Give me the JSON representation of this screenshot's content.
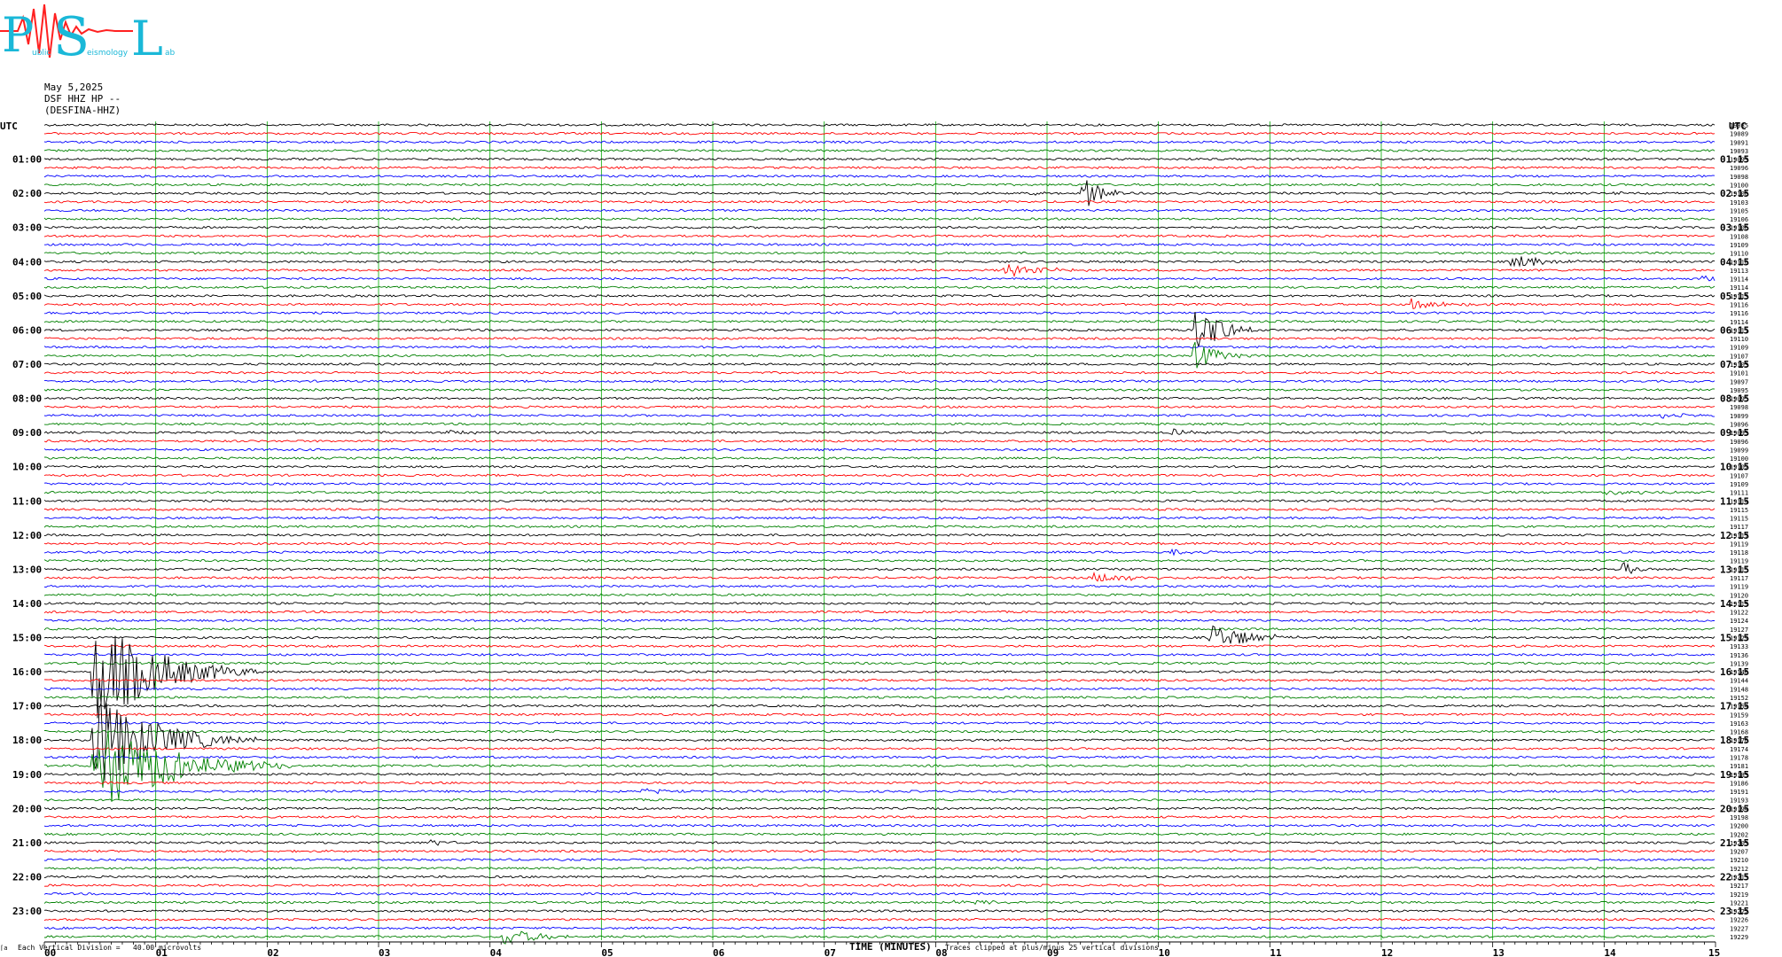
{
  "logo": {
    "letters": [
      "P",
      "S",
      "L"
    ],
    "subtitle_fragments": [
      "ublic",
      "eismology",
      "ab"
    ],
    "color": "#1ab8d8"
  },
  "header": {
    "date": "May 5,2025",
    "channel": "DSF HHZ HP --",
    "station": "(DESFINA-HHZ)"
  },
  "labels": {
    "utc_left": "UTC",
    "utc_right": "UTC",
    "xlabel": "TIME (MINUTES)",
    "scale_note": "Each Vertical Division =   40.00 microvolts",
    "clip_note": "Traces clipped at plus/minus 25 vertical divisions",
    "corner_mark": "⌈a"
  },
  "colors": {
    "trace_cycle": [
      "#000000",
      "#ff0000",
      "#0000ff",
      "#008000"
    ],
    "grid": "#00aa00"
  },
  "chart_data": {
    "type": "line",
    "title": "",
    "xlabel": "TIME (MINUTES)",
    "xlim": [
      0,
      15
    ],
    "x_ticks": [
      "00",
      "01",
      "02",
      "03",
      "04",
      "05",
      "06",
      "07",
      "08",
      "09",
      "10",
      "11",
      "12",
      "13",
      "14",
      "15"
    ],
    "traces_per_hour": 4,
    "trace_count": 96,
    "hour_labels_left": [
      "01:00",
      "02:00",
      "03:00",
      "04:00",
      "05:00",
      "06:00",
      "07:00",
      "08:00",
      "09:00",
      "10:00",
      "11:00",
      "12:00",
      "13:00",
      "14:00",
      "15:00",
      "16:00",
      "17:00",
      "18:00",
      "19:00",
      "20:00",
      "21:00",
      "22:00",
      "23:00"
    ],
    "hour_labels_right": [
      "01:15",
      "02:15",
      "03:15",
      "04:15",
      "05:15",
      "06:15",
      "07:15",
      "08:15",
      "09:15",
      "10:15",
      "11:15",
      "12:15",
      "13:15",
      "14:15",
      "15:15",
      "16:15",
      "17:15",
      "18:15",
      "19:15",
      "20:15",
      "21:15",
      "22:15",
      "23:15"
    ],
    "trace_offsets": [
      "19085",
      "19089",
      "19091",
      "19093",
      "19093",
      "19096",
      "19098",
      "19100",
      "19100",
      "19103",
      "19105",
      "19106",
      "19106",
      "19108",
      "19109",
      "19110",
      "19110",
      "19113",
      "19114",
      "19114",
      "19113",
      "19116",
      "19116",
      "19114",
      "19111",
      "19110",
      "19109",
      "19107",
      "19103",
      "19101",
      "19097",
      "19095",
      "19095",
      "19098",
      "19099",
      "19096",
      "19093",
      "19096",
      "19099",
      "19100",
      "19102",
      "19107",
      "19109",
      "19111",
      "19114",
      "19115",
      "19115",
      "19117",
      "19117",
      "19119",
      "19118",
      "19119",
      "19115",
      "19117",
      "19119",
      "19120",
      "19119",
      "19122",
      "19124",
      "19127",
      "19129",
      "19133",
      "19136",
      "19139",
      "19140",
      "19144",
      "19148",
      "19152",
      "19154",
      "19159",
      "19163",
      "19168",
      "19170",
      "19174",
      "19178",
      "19181",
      "19183",
      "19186",
      "19191",
      "19193",
      "19194",
      "19198",
      "19200",
      "19202",
      "19203",
      "19207",
      "19210",
      "19212",
      "19213",
      "19217",
      "19219",
      "19221",
      "19222",
      "19226",
      "19227",
      "19229"
    ],
    "events": [
      {
        "trace": 8,
        "minute": 8.83,
        "amplitude": 4,
        "duration": 0.12
      },
      {
        "trace": 8,
        "minute": 9.3,
        "amplitude": 24,
        "duration": 0.15
      },
      {
        "trace": 8,
        "minute": 14.05,
        "amplitude": 4,
        "duration": 0.1
      },
      {
        "trace": 16,
        "minute": 13.15,
        "amplitude": 8,
        "duration": 0.3
      },
      {
        "trace": 17,
        "minute": 8.6,
        "amplitude": 8,
        "duration": 0.3
      },
      {
        "trace": 18,
        "minute": 14.85,
        "amplitude": 3,
        "duration": 0.3
      },
      {
        "trace": 21,
        "minute": 12.25,
        "amplitude": 7,
        "duration": 0.25
      },
      {
        "trace": 24,
        "minute": 10.3,
        "amplitude": 40,
        "duration": 0.2
      },
      {
        "trace": 27,
        "minute": 10.3,
        "amplitude": 20,
        "duration": 0.2
      },
      {
        "trace": 34,
        "minute": 14.5,
        "amplitude": 4,
        "duration": 0.3
      },
      {
        "trace": 36,
        "minute": 10.1,
        "amplitude": 6,
        "duration": 0.2
      },
      {
        "trace": 36,
        "minute": 3.6,
        "amplitude": 3,
        "duration": 0.2
      },
      {
        "trace": 43,
        "minute": 14.0,
        "amplitude": 3,
        "duration": 0.4
      },
      {
        "trace": 50,
        "minute": 10.1,
        "amplitude": 5,
        "duration": 0.15
      },
      {
        "trace": 52,
        "minute": 14.15,
        "amplitude": 10,
        "duration": 0.1
      },
      {
        "trace": 53,
        "minute": 9.4,
        "amplitude": 6,
        "duration": 0.4
      },
      {
        "trace": 60,
        "minute": 10.45,
        "amplitude": 18,
        "duration": 0.3
      },
      {
        "trace": 64,
        "minute": 0.42,
        "amplitude": 70,
        "duration": 0.5
      },
      {
        "trace": 72,
        "minute": 0.42,
        "amplitude": 60,
        "duration": 0.5
      },
      {
        "trace": 75,
        "minute": 0.42,
        "amplitude": 60,
        "duration": 0.6
      },
      {
        "trace": 78,
        "minute": 5.35,
        "amplitude": 5,
        "duration": 0.15
      },
      {
        "trace": 84,
        "minute": 3.45,
        "amplitude": 6,
        "duration": 0.1
      },
      {
        "trace": 91,
        "minute": 8.1,
        "amplitude": 3,
        "duration": 0.4
      },
      {
        "trace": 95,
        "minute": 4.1,
        "amplitude": 12,
        "duration": 0.3
      }
    ]
  }
}
